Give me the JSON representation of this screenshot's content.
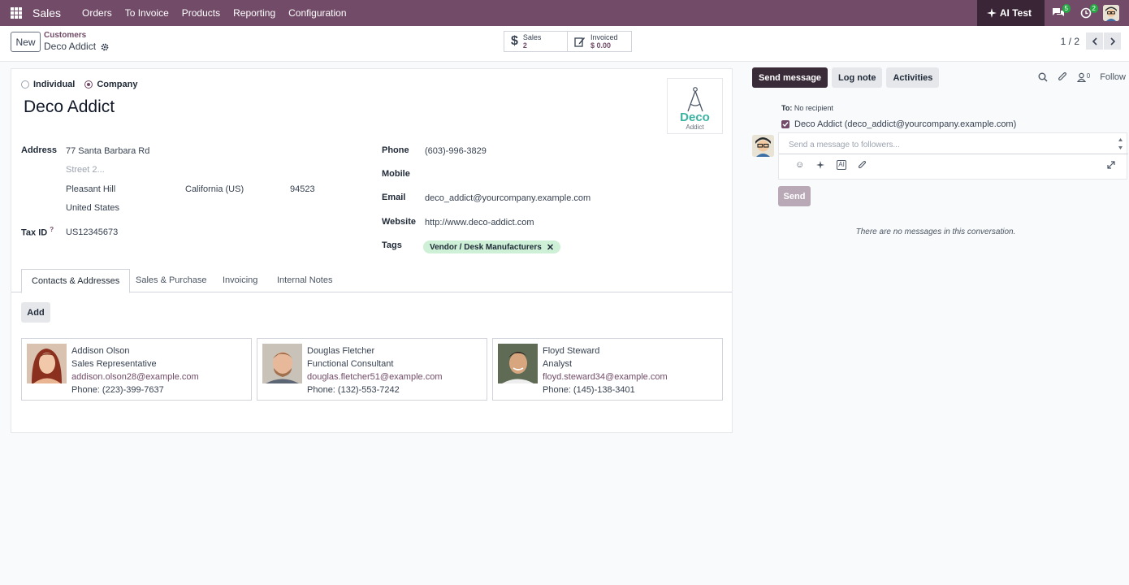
{
  "nav": {
    "app_name": "Sales",
    "menu": [
      "Orders",
      "To Invoice",
      "Products",
      "Reporting",
      "Configuration"
    ],
    "ai_label": "AI Test",
    "messages_badge": "5",
    "activities_badge": "2"
  },
  "control": {
    "new_label": "New",
    "breadcrumb_parent": "Customers",
    "breadcrumb_current": "Deco Addict",
    "stats": [
      {
        "label": "Sales",
        "value": "2",
        "icon": "dollar-icon"
      },
      {
        "label": "Invoiced",
        "value": "$ 0.00",
        "icon": "invoice-edit-icon"
      }
    ],
    "pager": "1 / 2"
  },
  "form": {
    "type_individual": "Individual",
    "type_company": "Company",
    "selected_type": "Company",
    "name": "Deco Addict",
    "logo_word": "Deco",
    "logo_sub": "Addict",
    "address_label": "Address",
    "street": "77 Santa Barbara Rd",
    "street2_placeholder": "Street 2...",
    "city": "Pleasant Hill",
    "state": "California (US)",
    "zip": "94523",
    "country": "United States",
    "tax_label": "Tax ID",
    "tax_help": "?",
    "tax_id": "US12345673",
    "phone_label": "Phone",
    "phone": "(603)-996-3829",
    "mobile_label": "Mobile",
    "email_label": "Email",
    "email": "deco_addict@yourcompany.example.com",
    "website_label": "Website",
    "website": "http://www.deco-addict.com",
    "tags_label": "Tags",
    "tag": "Vendor / Desk Manufacturers",
    "tabs": [
      "Contacts & Addresses",
      "Sales & Purchase",
      "Invoicing",
      "Internal Notes"
    ],
    "active_tab": "Contacts & Addresses",
    "add_label": "Add",
    "contacts": [
      {
        "name": "Addison Olson",
        "role": "Sales Representative",
        "email": "addison.olson28@example.com",
        "phone": "Phone: (223)-399-7637"
      },
      {
        "name": "Douglas Fletcher",
        "role": "Functional Consultant",
        "email": "douglas.fletcher51@example.com",
        "phone": "Phone: (132)-553-7242"
      },
      {
        "name": "Floyd Steward",
        "role": "Analyst",
        "email": "floyd.steward34@example.com",
        "phone": "Phone: (145)-138-3401"
      }
    ]
  },
  "chatter": {
    "send_message": "Send message",
    "log_note": "Log note",
    "activities": "Activities",
    "followers_count": "0",
    "follow": "Follow",
    "to_label": "To:",
    "to_value": "No recipient",
    "follower": "Deco Addict (deco_addict@yourcompany.example.com)",
    "composer_placeholder": "Send a message to followers...",
    "send": "Send",
    "empty": "There are no messages in this conversation."
  },
  "colors": {
    "brand": "#714b67",
    "tag_bg": "#cdf0d6",
    "logo": "#3bb3a2"
  }
}
